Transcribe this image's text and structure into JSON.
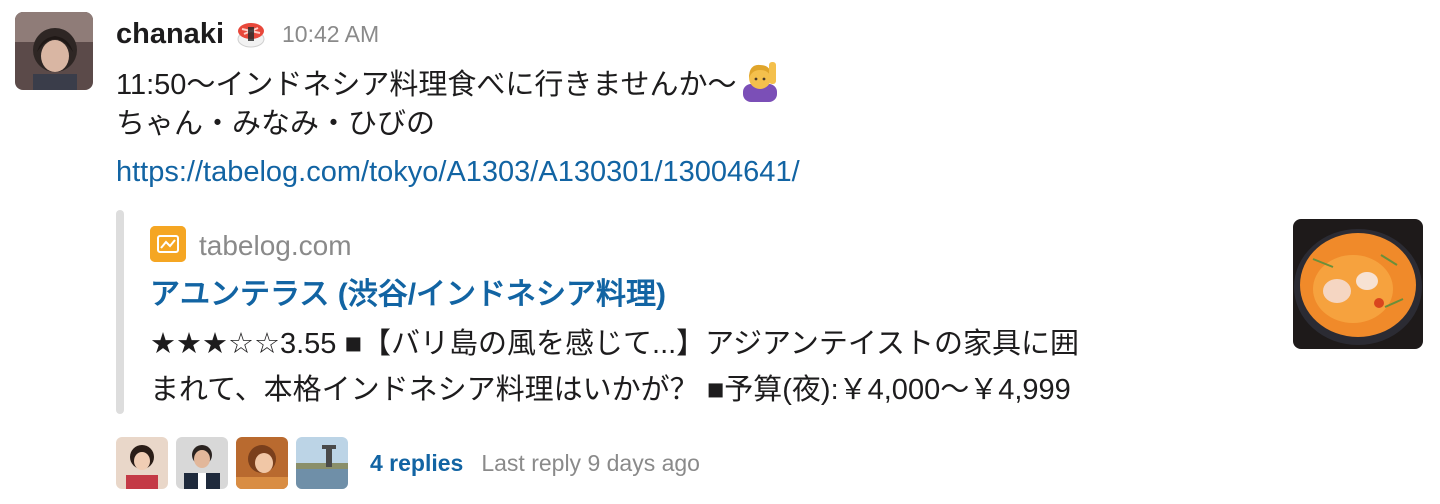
{
  "message": {
    "author": "chanaki",
    "author_status_icon": "sushi-emoji",
    "timestamp": "10:42 AM",
    "line1": "11:50〜インドネシア料理食べに行きませんか〜",
    "line1_emoji": "person-raising-hand-emoji",
    "line2": "ちゃん・みなみ・ひびの",
    "link": "https://tabelog.com/tokyo/A1303/A130301/13004641/"
  },
  "unfurl": {
    "service_icon": "tabelog-icon",
    "service_name": "tabelog.com",
    "title": "アユンテラス (渋谷/インドネシア料理)",
    "description_line1": "★★★☆☆3.55 ■【バリ島の風を感じて...】アジアンテイストの家具に囲",
    "description_line2": "まれて、本格インドネシア料理はいかが？ ■予算(夜):￥4,000〜￥4,999",
    "thumbnail": "curry-dish-thumbnail"
  },
  "thread": {
    "reply_count": "4 replies",
    "last_reply": "Last reply 9 days ago"
  },
  "colors": {
    "link": "#1264a3",
    "muted_text": "#8a8a8a",
    "text": "#1d1c1d",
    "unfurl_bar": "#dddddd",
    "tabelog_brand": "#f5a623"
  }
}
